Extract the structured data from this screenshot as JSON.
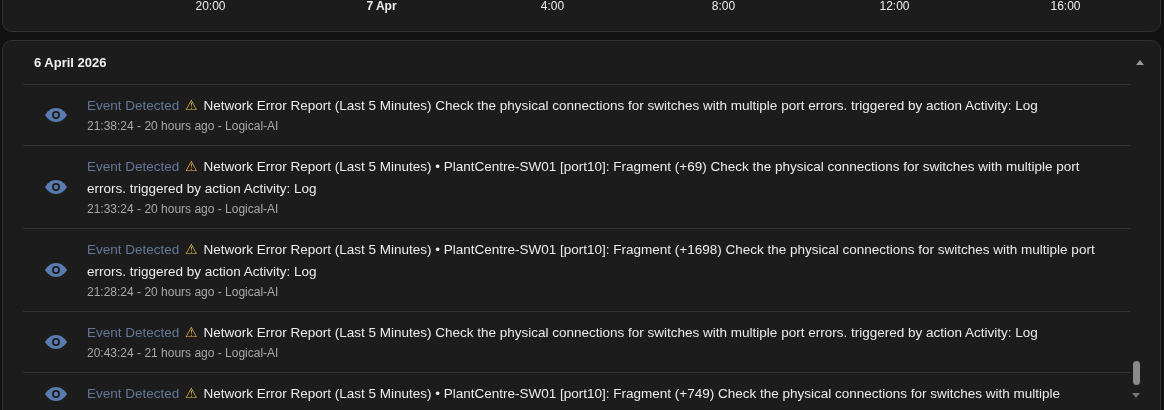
{
  "timeline": {
    "ticks": [
      {
        "label": "20:00",
        "kind": "time"
      },
      {
        "label": "7 Apr",
        "kind": "date"
      },
      {
        "label": "4:00",
        "kind": "time"
      },
      {
        "label": "8:00",
        "kind": "time"
      },
      {
        "label": "12:00",
        "kind": "time"
      },
      {
        "label": "16:00",
        "kind": "time"
      }
    ]
  },
  "day_section": {
    "title": "6 April 2026",
    "expanded": true,
    "events": [
      {
        "label": "Event Detected",
        "icon": "⚠",
        "message": "Network Error Report (Last 5 Minutes) Check the physical connections for switches with multiple port errors. triggered by action Activity: Log",
        "meta": "21:38:24 - 20 hours ago - Logical-AI"
      },
      {
        "label": "Event Detected",
        "icon": "⚠",
        "message": "Network Error Report (Last 5 Minutes) • PlantCentre-SW01 [port10]: Fragment (+69) Check the physical connections for switches with multiple port errors. triggered by action Activity: Log",
        "meta": "21:33:24 - 20 hours ago - Logical-AI"
      },
      {
        "label": "Event Detected",
        "icon": "⚠",
        "message": "Network Error Report (Last 5 Minutes) • PlantCentre-SW01 [port10]: Fragment (+1698) Check the physical connections for switches with multiple port errors. triggered by action Activity: Log",
        "meta": "21:28:24 - 20 hours ago - Logical-AI"
      },
      {
        "label": "Event Detected",
        "icon": "⚠",
        "message": "Network Error Report (Last 5 Minutes) Check the physical connections for switches with multiple port errors. triggered by action Activity: Log",
        "meta": "20:43:24 - 21 hours ago - Logical-AI"
      },
      {
        "label": "Event Detected",
        "icon": "⚠",
        "message": "Network Error Report (Last 5 Minutes) • PlantCentre-SW01 [port10]: Fragment (+749) Check the physical connections for switches with multiple"
      }
    ]
  }
}
